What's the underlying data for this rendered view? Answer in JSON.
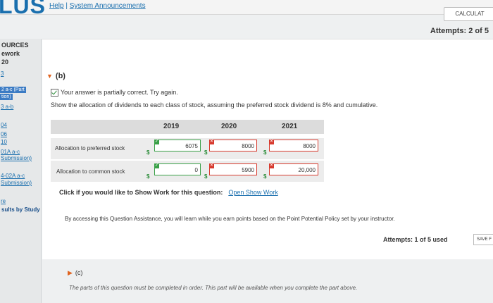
{
  "header": {
    "logo": "LUS",
    "help_link": "Help",
    "separator": "|",
    "announcements_link": "System Announcements",
    "calculator_label": "CALCULAT",
    "attempts": "Attempts: 2 of 5"
  },
  "sidebar": {
    "heading": "OURCES",
    "subheading": "ework",
    "number": "20",
    "items": [
      {
        "label": "3"
      },
      {
        "label": "2 a-c (Part"
      },
      {
        "label": "tion)"
      },
      {
        "label": "3 a-b"
      },
      {
        "label": "04"
      },
      {
        "label": "06"
      },
      {
        "label": "10"
      },
      {
        "label": "01A a-c"
      },
      {
        "label": "Submission)"
      },
      {
        "label": "4-02A a-c"
      },
      {
        "label": "Submission)"
      },
      {
        "label": "re"
      }
    ],
    "study_link": "sults by Study"
  },
  "part_b": {
    "label": "(b)",
    "feedback": "Your answer is partially correct.  Try again.",
    "instruction": "Show the allocation of dividends to each class of stock, assuming the preferred stock dividend is 8% and cumulative.",
    "years": [
      "2019",
      "2020",
      "2021"
    ],
    "rows": [
      {
        "label": "Allocation to preferred stock",
        "currency": "$",
        "values": [
          "6075",
          "8000",
          "8000"
        ],
        "status": [
          "correct",
          "incorrect",
          "incorrect"
        ]
      },
      {
        "label": "Allocation to common stock",
        "currency": "$",
        "values": [
          "0",
          "5900",
          "20,000"
        ],
        "status": [
          "correct",
          "incorrect",
          "incorrect"
        ]
      }
    ],
    "show_work_prompt": "Click if you would like to Show Work for this question:",
    "show_work_link": "Open Show Work",
    "assistance_note": "By accessing this Question Assistance, you will learn while you earn points based on the Point Potential Policy set by your instructor.",
    "attempts": "Attempts: 1 of 5 used",
    "save_label": "SAVE F"
  },
  "part_c": {
    "label": "(c)",
    "note": "The parts of this question must be completed in order. This part will be available when you complete the part above."
  },
  "colors": {
    "link": "#1a6fae",
    "correct": "#39a047",
    "incorrect": "#d73a2e",
    "accent": "#e0631f"
  },
  "icons": {
    "correct": "check-icon",
    "incorrect": "x-icon",
    "collapse": "caret-down-icon",
    "expand": "caret-right-icon"
  }
}
